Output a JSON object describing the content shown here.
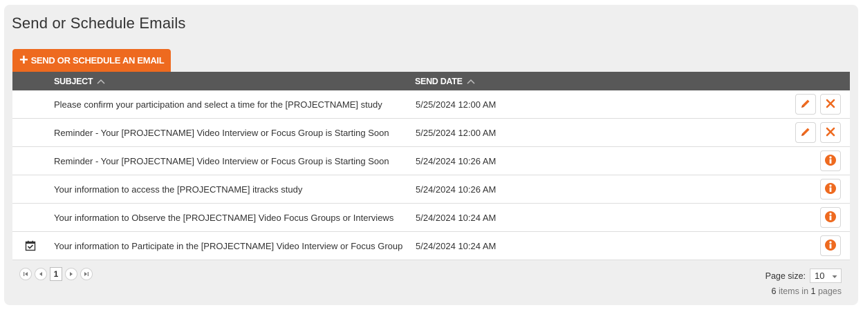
{
  "page": {
    "title": "Send or Schedule Emails",
    "add_button_label": "SEND OR SCHEDULE AN EMAIL"
  },
  "grid": {
    "columns": {
      "subject": "SUBJECT",
      "send_date": "SEND DATE"
    },
    "rows": [
      {
        "subject": "Please confirm your participation and select a time for the [PROJECTNAME] study",
        "send_date": "5/25/2024 12:00 AM",
        "actions": [
          "edit",
          "delete"
        ],
        "icon": ""
      },
      {
        "subject": "Reminder - Your [PROJECTNAME] Video Interview or Focus Group is Starting Soon",
        "send_date": "5/25/2024 12:00 AM",
        "actions": [
          "edit",
          "delete"
        ],
        "icon": ""
      },
      {
        "subject": "Reminder - Your [PROJECTNAME] Video Interview or Focus Group is Starting Soon",
        "send_date": "5/24/2024 10:26 AM",
        "actions": [
          "info"
        ],
        "icon": ""
      },
      {
        "subject": "Your information to access the [PROJECTNAME] itracks study",
        "send_date": "5/24/2024 10:26 AM",
        "actions": [
          "info"
        ],
        "icon": ""
      },
      {
        "subject": "Your information to Observe the [PROJECTNAME] Video Focus Groups or Interviews",
        "send_date": "5/24/2024 10:24 AM",
        "actions": [
          "info"
        ],
        "icon": ""
      },
      {
        "subject": "Your information to Participate in the [PROJECTNAME] Video Interview or Focus Group",
        "send_date": "5/24/2024 10:24 AM",
        "actions": [
          "info"
        ],
        "icon": "calendar-check-icon"
      }
    ]
  },
  "pager": {
    "current_page": "1",
    "page_size_label": "Page size:",
    "page_size_value": "10",
    "items_count": "6",
    "items_mid": " items in ",
    "pages_count": "1",
    "pages_suffix": " pages"
  },
  "colors": {
    "accent": "#ee6a1f",
    "header_bg": "#585858",
    "panel_bg": "#efefef"
  }
}
